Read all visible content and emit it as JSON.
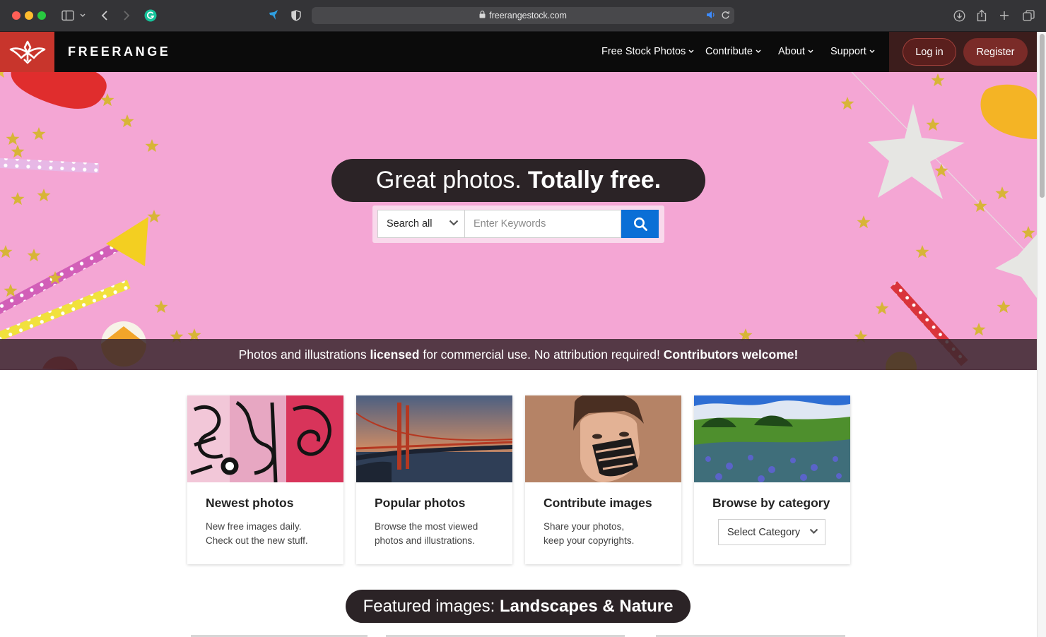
{
  "browser": {
    "url": "freerangestock.com"
  },
  "header": {
    "brand": "FREERANGE",
    "nav": [
      {
        "label": "Free Stock Photos"
      },
      {
        "label": "Contribute"
      },
      {
        "label": "About"
      },
      {
        "label": "Support"
      }
    ],
    "login_label": "Log in",
    "register_label": "Register"
  },
  "hero": {
    "headline_light": "Great photos.",
    "headline_bold": "Totally free.",
    "search_scope": "Search all",
    "search_placeholder": "Enter Keywords",
    "tagline": {
      "part1": "Photos and illustrations ",
      "bold1": "licensed",
      "part2": " for commercial use. No attribution required! ",
      "bold2": "Contributors welcome!"
    }
  },
  "cards": [
    {
      "title": "Newest photos",
      "line1": "New free images daily.",
      "line2": "Check out the new stuff."
    },
    {
      "title": "Popular photos",
      "line1": "Browse the most viewed",
      "line2": "photos and illustrations."
    },
    {
      "title": "Contribute images",
      "line1": "Share your photos,",
      "line2": "keep your copyrights."
    },
    {
      "title": "Browse by category",
      "select_label": "Select Category"
    }
  ],
  "featured": {
    "prefix": "Featured images: ",
    "topic": "Landscapes & Nature"
  },
  "colors": {
    "brand_red": "#c8352c",
    "header_bg": "#0b0b0b",
    "hero_pink": "#f4a6d4",
    "search_blue": "#0a6fd6",
    "pill_dark": "#2b2326"
  }
}
